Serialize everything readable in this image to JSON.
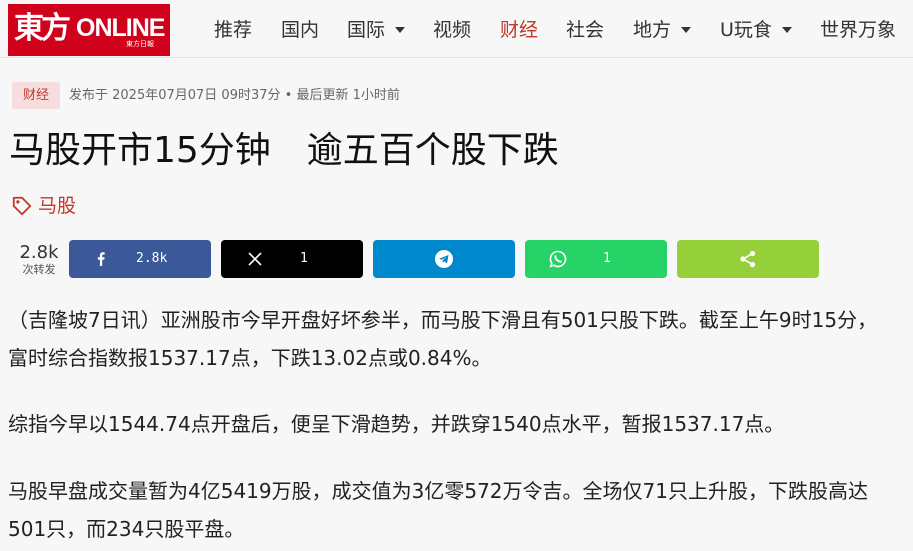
{
  "header": {
    "logo_cn": "東方",
    "logo_en": "ONLINE",
    "logo_sub": "東方日報",
    "nav": [
      {
        "label": "推荐"
      },
      {
        "label": "国内"
      },
      {
        "label": "国际"
      },
      {
        "label": "视频"
      },
      {
        "label": "财经"
      },
      {
        "label": "社会"
      },
      {
        "label": "地方"
      },
      {
        "label": "U玩食"
      },
      {
        "label": "世界万象"
      }
    ]
  },
  "article": {
    "category": "财经",
    "meta": "发布于 2025年07月07日 09时37分 • 最后更新 1小时前",
    "title": "马股开市15分钟　逾五百个股下跌",
    "tag": "马股",
    "share": {
      "total": "2.8k",
      "total_label": "次转发",
      "facebook_count": "2.8k",
      "x_count": "1",
      "whatsapp_count": "1"
    },
    "paragraphs": [
      "（吉隆坡7日讯）亚洲股市今早开盘好坏参半，而马股下滑且有501只股下跌。截至上午9时15分，",
      "富时综合指数报1537.17点，下跌13.02点或0.84%。",
      "综指今早以1544.74点开盘后，便呈下滑趋势，并跌穿1540点水平，暂报1537.17点。",
      "马股早盘成交量暂为4亿5419万股，成交值为3亿零572万令吉。全场仅71只上升股，下跌股高达",
      "501只，而234只股平盘。"
    ]
  },
  "colors": {
    "brand_red": "#d0021b",
    "facebook": "#3b5998",
    "x": "#000000",
    "telegram": "#0088cc",
    "whatsapp": "#25d366",
    "sharethis": "#95d03a"
  }
}
